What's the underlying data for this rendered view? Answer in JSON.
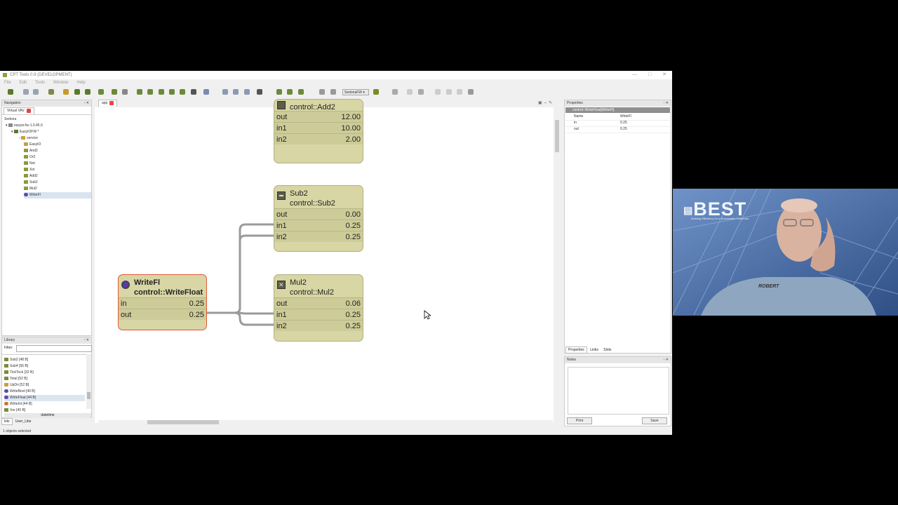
{
  "window": {
    "title": "CPT Tools 0.9 (DEVELOPMENT)"
  },
  "menu": [
    "File",
    "Edit",
    "Tools",
    "Window",
    "Help"
  ],
  "toolbar": {
    "select_value": "SedonaFW"
  },
  "navigation": {
    "title": "Navigation",
    "tab": "Virtual VAV",
    "tree": [
      {
        "label": "Sedona",
        "depth": 0
      },
      {
        "label": "easyio-fw-1.0.45.0",
        "depth": 1
      },
      {
        "label": "EasyIOFW *",
        "depth": 2
      },
      {
        "label": "service",
        "depth": 3
      },
      {
        "label": "EasyIO",
        "depth": 3
      },
      {
        "label": "And2",
        "depth": 3
      },
      {
        "label": "Or2",
        "depth": 3
      },
      {
        "label": "Not",
        "depth": 3
      },
      {
        "label": "Xor",
        "depth": 3
      },
      {
        "label": "Add2",
        "depth": 3
      },
      {
        "label": "Sub2",
        "depth": 3
      },
      {
        "label": "Mul2",
        "depth": 3
      },
      {
        "label": "WriteFl",
        "depth": 3,
        "selected": true
      }
    ]
  },
  "library": {
    "title": "Library",
    "filter_label": "Filter:",
    "filter_value": "",
    "items": [
      {
        "label": "Sub2 [48 B]"
      },
      {
        "label": "Sub4 [56 B]"
      },
      {
        "label": "TickTock [32 B]"
      },
      {
        "label": "Total [52 B]"
      },
      {
        "label": "UpDn [52 B]"
      },
      {
        "label": "WriteBool [40 B]"
      },
      {
        "label": "WriteFloat [44 B]",
        "selected": true
      },
      {
        "label": "WriteInt [44 B]"
      },
      {
        "label": "Xor [40 B]"
      }
    ],
    "group": "datetime",
    "tabs": [
      "kits",
      "User_Libs"
    ]
  },
  "editor": {
    "tab": "app",
    "components": [
      {
        "id": "add2",
        "name": "",
        "type": "control::Add2",
        "slots": [
          {
            "n": "out",
            "v": "12.00"
          },
          {
            "n": "in1",
            "v": "10.00"
          },
          {
            "n": "in2",
            "v": "2.00"
          }
        ]
      },
      {
        "id": "sub2",
        "name": "Sub2",
        "type": "control::Sub2",
        "slots": [
          {
            "n": "out",
            "v": "0.00"
          },
          {
            "n": "in1",
            "v": "0.25"
          },
          {
            "n": "in2",
            "v": "0.25"
          }
        ]
      },
      {
        "id": "mul2",
        "name": "Mul2",
        "type": "control::Mul2",
        "slots": [
          {
            "n": "out",
            "v": "0.06"
          },
          {
            "n": "in1",
            "v": "0.25"
          },
          {
            "n": "in2",
            "v": "0.25"
          }
        ]
      },
      {
        "id": "writefl",
        "name": "WriteFl",
        "type": "control::WriteFloat",
        "slots": [
          {
            "n": "in",
            "v": "0.25"
          },
          {
            "n": "out",
            "v": "0.25"
          }
        ]
      }
    ]
  },
  "properties": {
    "title": "Properties",
    "header": "control::WriteFloat[WriteFl]",
    "rows": [
      {
        "k": "Name",
        "v": "WriteFl"
      },
      {
        "k": "in",
        "v": "0.25"
      },
      {
        "k": "out",
        "v": "0.25"
      }
    ],
    "tabs": [
      "Properties",
      "Links",
      "Slots"
    ]
  },
  "notes": {
    "title": "Notes",
    "print": "Print",
    "save": "Save"
  },
  "status": "1 objects selected",
  "webcam": {
    "logo": "BEST",
    "tagline": "Building Efficiency for a Sustainable Tomorrow",
    "shirt": "ROBERT"
  },
  "colors": {
    "component": "#d7d6a4",
    "selected_border": "#e05a3a",
    "wire": "#9a9a9a"
  }
}
